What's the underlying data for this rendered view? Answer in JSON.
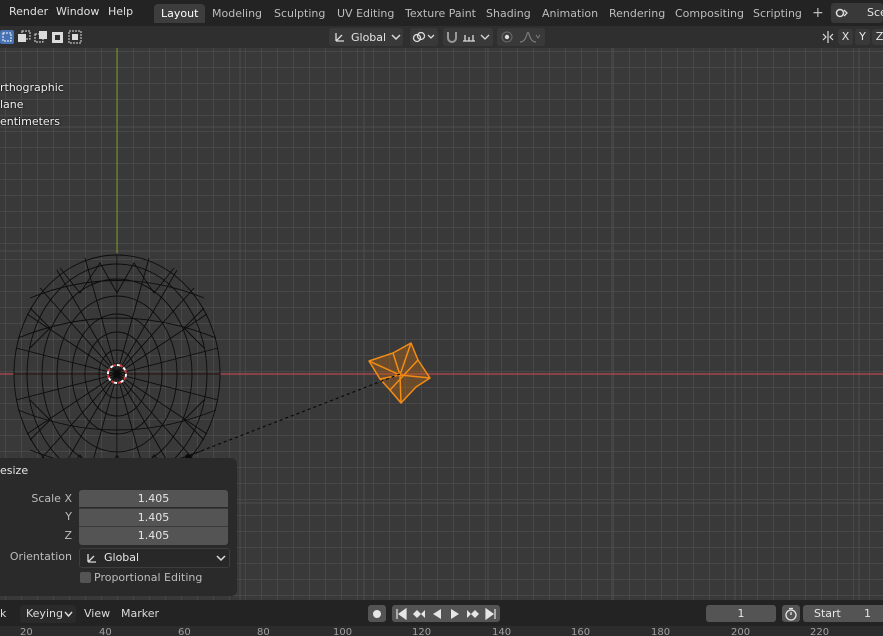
{
  "menu": [
    "Render",
    "Window",
    "Help"
  ],
  "workspaces": [
    {
      "label": "Layout",
      "active": true
    },
    {
      "label": "Modeling"
    },
    {
      "label": "Sculpting"
    },
    {
      "label": "UV Editing"
    },
    {
      "label": "Texture Paint"
    },
    {
      "label": "Shading"
    },
    {
      "label": "Animation"
    },
    {
      "label": "Rendering"
    },
    {
      "label": "Compositing"
    },
    {
      "label": "Scripting"
    }
  ],
  "add_workspace": "+",
  "scene_label": "Sce",
  "header": {
    "orientation_value": "Global",
    "axis_x": "X",
    "axis_y": "Y",
    "axis_z": "Z"
  },
  "overlay": {
    "view_name": "rthographic",
    "object_name": "lane",
    "units": "entimeters"
  },
  "redo_panel": {
    "title": "esize",
    "scale_x_label": "Scale X",
    "y_label": "Y",
    "z_label": "Z",
    "scale_x": "1.405",
    "scale_y": "1.405",
    "scale_z": "1.405",
    "orientation_label": "Orientation",
    "orientation_value": "Global",
    "proportional_label": "Proportional Editing",
    "proportional_checked": false
  },
  "timeline": {
    "left_cut": "k",
    "keying": "Keying",
    "view": "View",
    "marker": "Marker",
    "current_frame": "1",
    "start_label": "Start",
    "start_value": "1",
    "ruler_ticks": [
      "20",
      "40",
      "60",
      "80",
      "100",
      "120",
      "140",
      "160",
      "180",
      "200",
      "220"
    ]
  },
  "colors": {
    "accent_tab": "#3d3d3d",
    "selection_orange": "#f28c14",
    "x_axis": "#b5494f",
    "y_axis": "#6d8a2d",
    "field_bg": "#545454"
  }
}
